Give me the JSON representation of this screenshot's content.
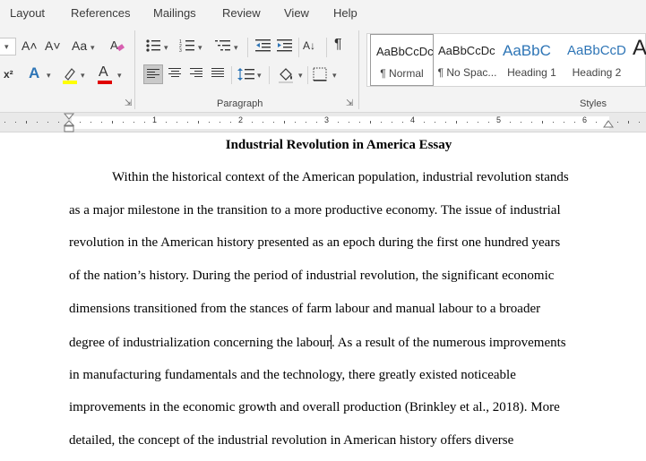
{
  "ribbon_tabs": [
    "Layout",
    "References",
    "Mailings",
    "Review",
    "View",
    "Help"
  ],
  "font_group": {
    "grow_font": "A˄",
    "shrink_font": "A˅",
    "change_case": "Aa",
    "superscript": "x²",
    "text_effects": "A",
    "font_color": "A"
  },
  "paragraph_group": {
    "label": "Paragraph",
    "sort": "A↓",
    "pilcrow": "¶"
  },
  "styles_group": {
    "label": "Styles",
    "items": [
      {
        "sample": "AaBbCcDc",
        "name": "¶ Normal"
      },
      {
        "sample": "AaBbCcDc",
        "name": "¶ No Spac..."
      },
      {
        "sample": "AaBbC",
        "name": "Heading 1"
      },
      {
        "sample": "AaBbCcD",
        "name": "Heading 2"
      },
      {
        "sample": "A",
        "name": ""
      }
    ]
  },
  "colors": {
    "highlight": "#ffff00",
    "font_color": "#e00000",
    "heading_blue": "#2f5597",
    "text_effect_blue": "#2e75b6"
  },
  "ruler": {
    "numbers": [
      "1",
      "2",
      "3",
      "4",
      "5",
      "6"
    ]
  },
  "document": {
    "title": "Industrial Revolution in America Essay",
    "lines": [
      "Within the historical context of the American population, industrial revolution stands",
      "as a major milestone in the transition to a more productive economy. The issue of industrial",
      "revolution in the American history presented as an epoch during the first one hundred years",
      "of the nation’s history. During the period of industrial revolution, the significant economic",
      "dimensions transitioned from the stances of farm labour and manual labour to a broader",
      "degree of industrialization concerning the labour",
      "in manufacturing fundamentals and the technology, there greatly existed noticeable",
      "improvements in the economic growth and overall production (Brinkley et al., 2018). More",
      "detailed, the concept of the industrial revolution in American history offers diverse"
    ],
    "line6_after_cursor": ". As a result of the numerous improvements"
  }
}
